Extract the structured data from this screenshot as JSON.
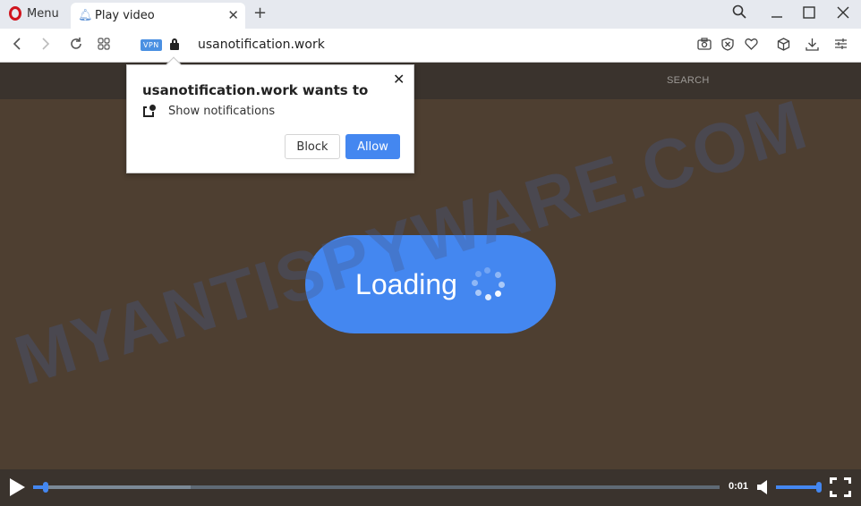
{
  "browser": {
    "menu_label": "Menu",
    "tab": {
      "title": "Play video",
      "favicon": "bell-icon"
    },
    "address": {
      "vpn_badge": "VPN",
      "url": "usanotification.work",
      "secure": true
    },
    "icons": {
      "back": "‹",
      "forward": "›",
      "reload": "↻",
      "speed_dial": "⊞",
      "new_tab": "+",
      "tab_close": "✕",
      "search": "⌕",
      "minimize": "—",
      "maximize": "☐",
      "close": "✕",
      "snapshot": "📷",
      "adblock": "⛒",
      "heart": "♡",
      "cube": "⬡",
      "download": "⤓",
      "easy_setup": "☰"
    }
  },
  "page": {
    "header": {
      "search_label": "SEARCH"
    },
    "watermark": "MYANTISPYWARE.COM",
    "loading": {
      "label": "Loading"
    },
    "accent_color": "#4487f0",
    "background_color": "#4e3f31"
  },
  "player": {
    "time": "0:01",
    "progress_fraction": 0.018,
    "buffered_fraction": 0.23,
    "volume_fraction": 1.0
  },
  "permission_popup": {
    "title": "usanotification.work wants to",
    "permission": "Show notifications",
    "close_glyph": "✕",
    "block_label": "Block",
    "allow_label": "Allow"
  }
}
